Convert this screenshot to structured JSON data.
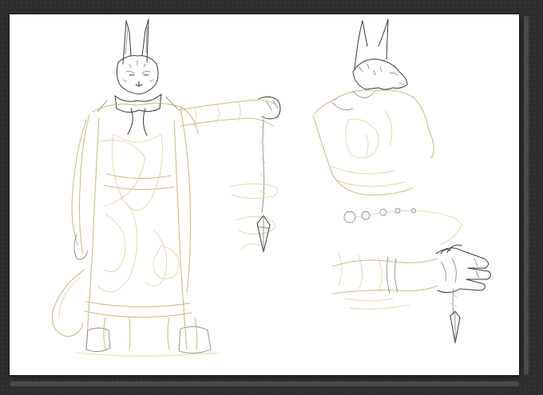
{
  "app": {
    "workspace_color": "#2d2d2d",
    "canvas_color": "#ffffff"
  },
  "artwork": {
    "colors": {
      "sketch_gold": "#c9b06a",
      "sketch_gold_light": "#ddc98e",
      "lineart": "#3a3a3a",
      "lineart_gray": "#8c8c8c"
    },
    "figures": [
      "full-body-character",
      "back-view-bust",
      "hand-with-pendulum"
    ]
  }
}
